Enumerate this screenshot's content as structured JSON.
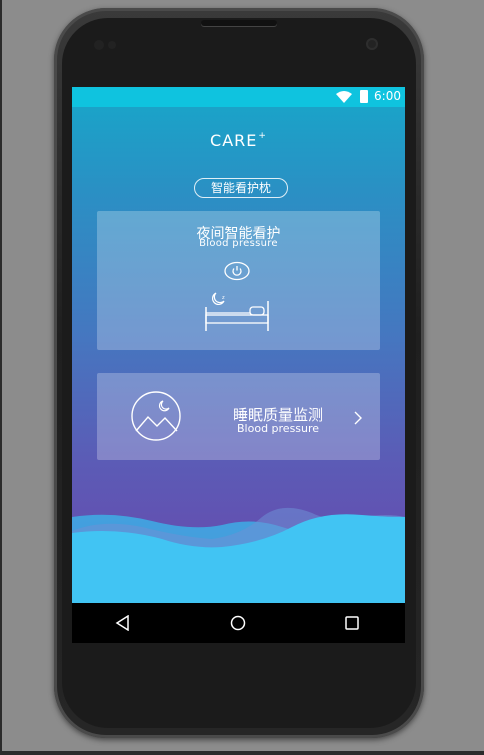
{
  "status_bar": {
    "time": "6:00",
    "wifi_icon": "wifi-icon",
    "battery_icon": "battery-icon",
    "color": "#0fc3df"
  },
  "header": {
    "app_title": "CARE",
    "app_title_sup": "+"
  },
  "pill": {
    "label": "智能看护枕"
  },
  "card_night": {
    "title": "夜间智能看护",
    "subtitle": "Blood pressure",
    "icons": [
      "power-icon",
      "moon-bed-icon"
    ]
  },
  "card_sleep": {
    "title": "睡眠质量监测",
    "subtitle": "Blood pressure",
    "icons": [
      "mountain-moon-icon",
      "chevron-right-icon"
    ]
  },
  "nav_bar": {
    "buttons": [
      "back",
      "home",
      "recent-apps"
    ]
  },
  "colors": {
    "gradient_top": "#17a7c9",
    "gradient_bottom": "#6a46ad",
    "wave": "#3fc6f2"
  }
}
